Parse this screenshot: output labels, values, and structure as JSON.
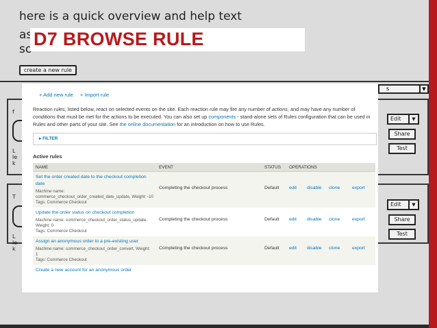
{
  "headline": "D7 BROWSE RULE",
  "mockup": {
    "title_line1": "here is a quick overview and help text",
    "title_frag2": "as",
    "title_frag3": "so",
    "create_button": "create a new rule",
    "select_suffix": "s",
    "left_frag_a": "f",
    "left_frag_b": "L\nle\nk",
    "left_frag_c": "T",
    "left_frag_d": "L\nle\nk",
    "edit_label": "Edit",
    "share_label": "Share",
    "test_label": "Test"
  },
  "panel": {
    "links": {
      "add": "+ Add new rule",
      "import": "+ Import rule"
    },
    "intro": {
      "p1": "Reaction rules, listed below, react on selected events on the site. Each reaction rule may fire any number of ",
      "actions": "actions",
      "p2": ", and may have any number of ",
      "conditions": "conditions",
      "p3": " that must be met for the actions to be executed. You can also set up ",
      "components": "components",
      "p4": " - stand-alone sets of Rules configuration that can be used in Rules and other parts of your site. See ",
      "doc_link": "the online documentation",
      "p5": " for an introduction on how to use Rules."
    },
    "filter": "▸ FILTER",
    "active_heading": "Active rules",
    "columns": {
      "name": "NAME",
      "event": "EVENT",
      "status": "STATUS",
      "operations": "OPERATIONS"
    },
    "rows": [
      {
        "name": "Set the order created date to the checkout completion date",
        "meta": "Machine name: commerce_checkout_order_created_date_update, Weight: -10\nTags: Commerce Checkout",
        "event": "Completing the checkout process",
        "status": "Default",
        "ops": [
          "edit",
          "disable",
          "clone",
          "export"
        ]
      },
      {
        "name": "Update the order status on checkout completion",
        "meta": "Machine name: commerce_checkout_order_status_update, Weight: 0\nTags: Commerce Checkout",
        "event": "Completing the checkout process",
        "status": "Default",
        "ops": [
          "edit",
          "disable",
          "clone",
          "export"
        ]
      },
      {
        "name": "Assign an anonymous order to a pre-existing user",
        "meta": "Machine name: commerce_checkout_order_convert, Weight: 1\nTags: Commerce Checkout",
        "event": "Completing the checkout process",
        "status": "Default",
        "ops": [
          "edit",
          "disable",
          "clone",
          "export"
        ]
      },
      {
        "name": "Create a new account for an anonymous order",
        "meta": "",
        "event": "",
        "status": "",
        "ops": []
      }
    ]
  },
  "colors": {
    "accent_red": "#b8191c",
    "link_blue": "#0074bd"
  }
}
